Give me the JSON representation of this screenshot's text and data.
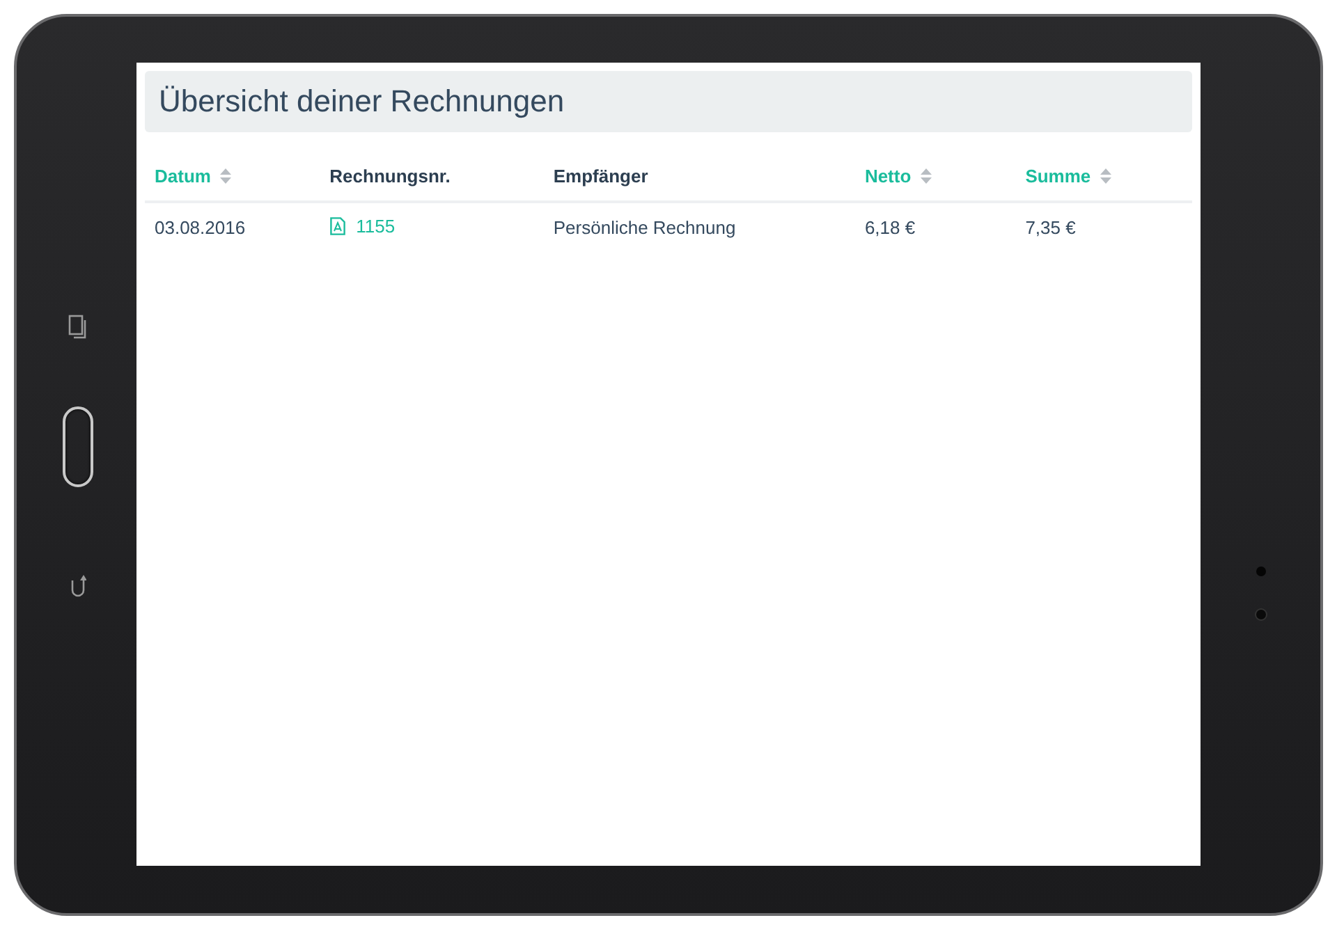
{
  "page": {
    "title": "Übersicht deiner Rechnungen"
  },
  "table": {
    "columns": [
      {
        "label": "Datum",
        "sortable": true
      },
      {
        "label": "Rechnungsnr.",
        "sortable": false
      },
      {
        "label": "Empfänger",
        "sortable": false
      },
      {
        "label": "Netto",
        "sortable": true
      },
      {
        "label": "Summe",
        "sortable": true
      }
    ],
    "rows": [
      {
        "cells": [
          {
            "kind": "text",
            "text": "03.08.2016"
          },
          {
            "kind": "pdf-link",
            "text": "1155"
          },
          {
            "kind": "text",
            "text": "Persönliche Rechnung"
          },
          {
            "kind": "text",
            "text": "6,18 €"
          },
          {
            "kind": "text",
            "text": "7,35 €"
          }
        ]
      }
    ]
  }
}
